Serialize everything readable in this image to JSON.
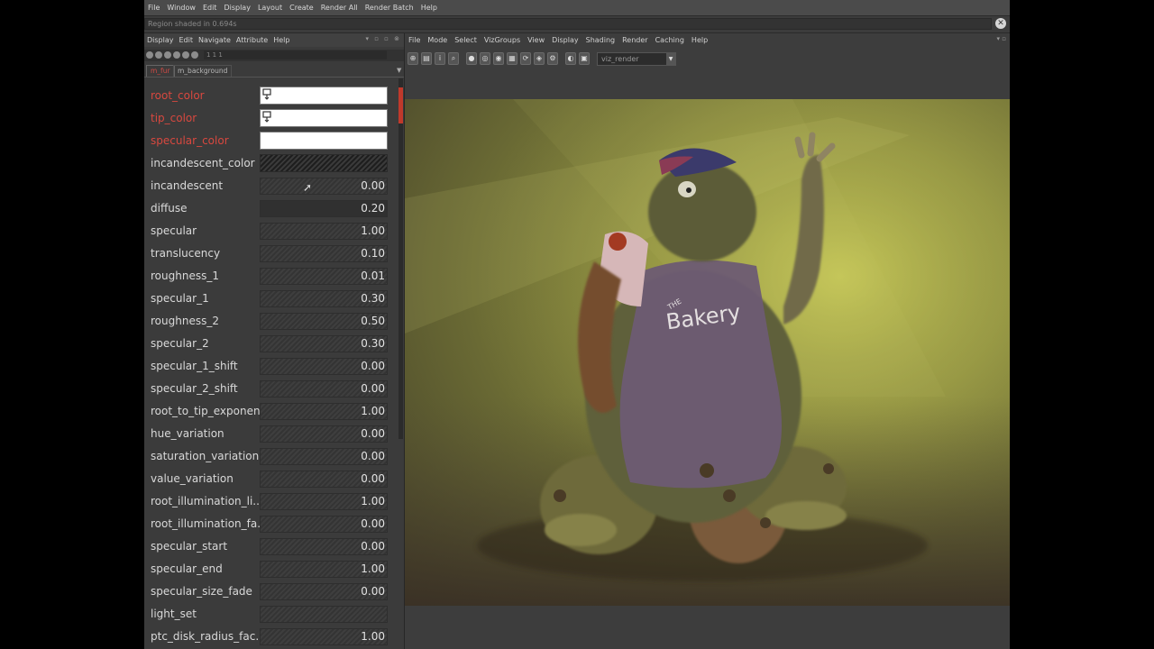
{
  "top_menu": [
    "File",
    "Window",
    "Edit",
    "Display",
    "Layout",
    "Create",
    "Render All",
    "Render Batch",
    "Help"
  ],
  "status_text": "Region shaded in 0.694s",
  "attr_editor": {
    "menu": [
      "Display",
      "Edit",
      "Navigate",
      "Attribute",
      "Help"
    ],
    "toolbar_text": "1 1 1",
    "tabs": [
      "m_fur",
      "m_background"
    ],
    "rows": [
      {
        "label": "root_color",
        "kind": "color",
        "linked": true
      },
      {
        "label": "tip_color",
        "kind": "color",
        "linked": true
      },
      {
        "label": "specular_color",
        "kind": "color",
        "linked": true
      },
      {
        "label": "incandescent_color",
        "kind": "color-dark",
        "linked": false
      },
      {
        "label": "incandescent",
        "value": "0.00"
      },
      {
        "label": "diffuse",
        "value": "0.20"
      },
      {
        "label": "specular",
        "value": "1.00"
      },
      {
        "label": "translucency",
        "value": "0.10"
      },
      {
        "label": "roughness_1",
        "value": "0.01"
      },
      {
        "label": "specular_1",
        "value": "0.30"
      },
      {
        "label": "roughness_2",
        "value": "0.50"
      },
      {
        "label": "specular_2",
        "value": "0.30"
      },
      {
        "label": "specular_1_shift",
        "value": "0.00"
      },
      {
        "label": "specular_2_shift",
        "value": "0.00"
      },
      {
        "label": "root_to_tip_exponent",
        "value": "1.00"
      },
      {
        "label": "hue_variation",
        "value": "0.00"
      },
      {
        "label": "saturation_variation",
        "value": "0.00"
      },
      {
        "label": "value_variation",
        "value": "0.00"
      },
      {
        "label": "root_illumination_li...",
        "value": "1.00"
      },
      {
        "label": "root_illumination_fa...",
        "value": "0.00"
      },
      {
        "label": "specular_start",
        "value": "0.00"
      },
      {
        "label": "specular_end",
        "value": "1.00"
      },
      {
        "label": "specular_size_fade",
        "value": "0.00"
      },
      {
        "label": "light_set",
        "value": ""
      },
      {
        "label": "ptc_disk_radius_fac...",
        "value": "1.00"
      }
    ]
  },
  "render_view": {
    "menu": [
      "File",
      "Mode",
      "Select",
      "VizGroups",
      "View",
      "Display",
      "Shading",
      "Render",
      "Caching",
      "Help"
    ],
    "camera": "viz_render",
    "apron_text": "Bakery",
    "apron_small_text": "THE"
  },
  "colors": {
    "linked_label": "#d8483f",
    "accent": "#c0392b"
  }
}
